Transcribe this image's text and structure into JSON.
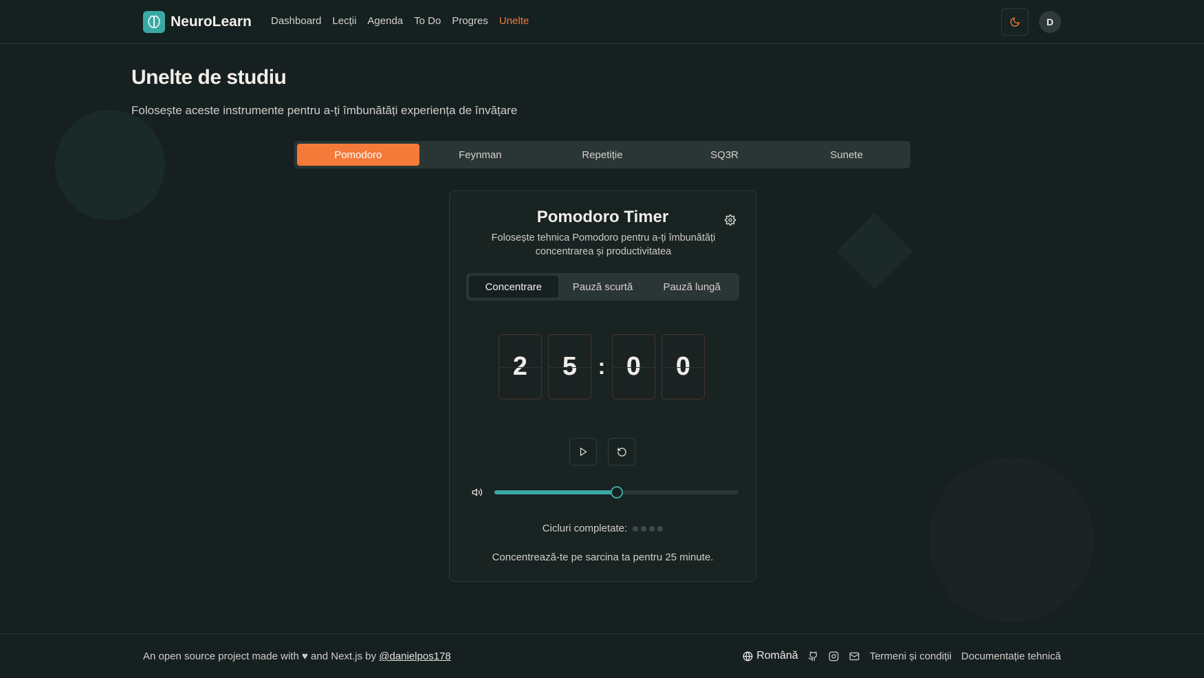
{
  "header": {
    "brand": "NeuroLearn",
    "nav": [
      "Dashboard",
      "Lecții",
      "Agenda",
      "To Do",
      "Progres",
      "Unelte"
    ],
    "active_nav": "Unelte",
    "avatar_initial": "D"
  },
  "page": {
    "title": "Unelte de studiu",
    "subtitle": "Folosește aceste instrumente pentru a-ți îmbunătăți experiența de învățare"
  },
  "tool_tabs": [
    "Pomodoro",
    "Feynman",
    "Repetiție",
    "SQ3R",
    "Sunete"
  ],
  "active_tool_tab": "Pomodoro",
  "timer": {
    "title": "Pomodoro Timer",
    "description": "Folosește tehnica Pomodoro pentru a-ți îmbunătăți concentrarea și productivitatea",
    "modes": [
      "Concentrare",
      "Pauză scurtă",
      "Pauză lungă"
    ],
    "active_mode": "Concentrare",
    "digits": [
      "2",
      "5",
      "0",
      "0"
    ],
    "separator": ":",
    "volume_percent": 50,
    "cycles_label": "Cicluri completate:",
    "cycles_total": 4,
    "cycles_completed": 0,
    "message": "Concentrează-te pe sarcina ta pentru 25 minute."
  },
  "footer": {
    "text_before": "An open source project made with ♥ and Next.js by ",
    "author_link": "@danielpos178",
    "language": "Română",
    "terms": "Termeni și condiții",
    "docs": "Documentație tehnică"
  },
  "colors": {
    "accent": "#f47a3a",
    "teal": "#3aa9a4",
    "background": "#162020"
  },
  "icons": [
    "brain-icon",
    "moon-icon",
    "gear-icon",
    "play-icon",
    "reset-icon",
    "volume-icon",
    "globe-icon",
    "github-icon",
    "instagram-icon",
    "mail-icon"
  ]
}
